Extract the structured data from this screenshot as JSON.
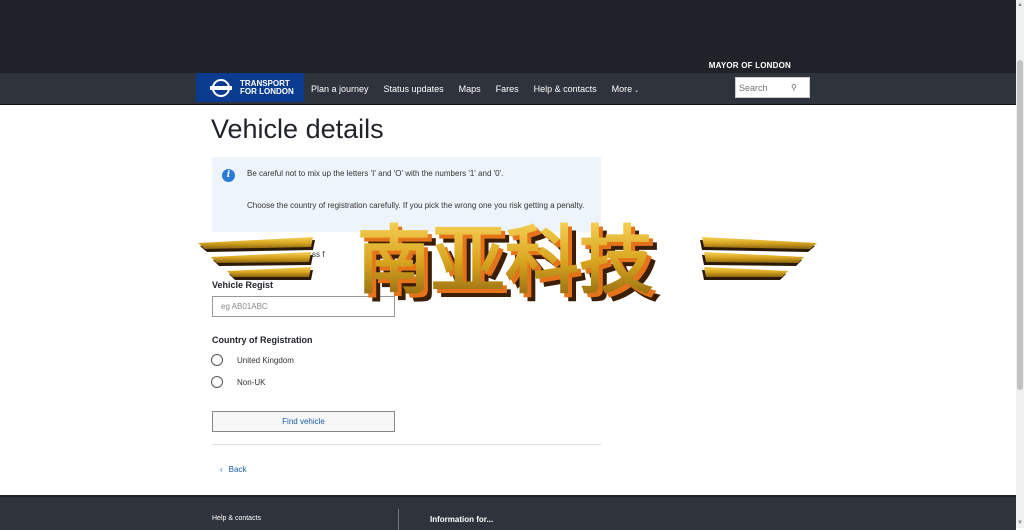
{
  "header": {
    "mayor_text": "MAYOR OF LONDON",
    "logo_line1": "TRANSPORT",
    "logo_line2": "FOR LONDON",
    "nav": [
      "Plan a journey",
      "Status updates",
      "Maps",
      "Fares",
      "Help & contacts",
      "More"
    ],
    "more_chevron": "chevron-down-icon",
    "search_placeholder": "Search",
    "search_icon": "search-icon"
  },
  "page": {
    "title": "Vehicle details",
    "info_line1": "Be careful not to mix up the letters 'I' and 'O' with the numbers '1' and '0'.",
    "info_line2": "Choose the country of registration carefully. If you pick the wrong one you risk getting a penalty.",
    "hidden_line": "ss f",
    "reg_label": "Vehicle Regist",
    "reg_placeholder": "eg AB01ABC",
    "country_label": "Country of Registration",
    "options": [
      "United Kingdom",
      "Non-UK"
    ],
    "find_button": "Find vehicle",
    "back": "Back"
  },
  "overlay": {
    "text": "南亚科技",
    "color_gold": "#d9a520",
    "color_orange": "#e5731a"
  },
  "footer": {
    "help": "Help & contacts",
    "info": "Information for..."
  }
}
